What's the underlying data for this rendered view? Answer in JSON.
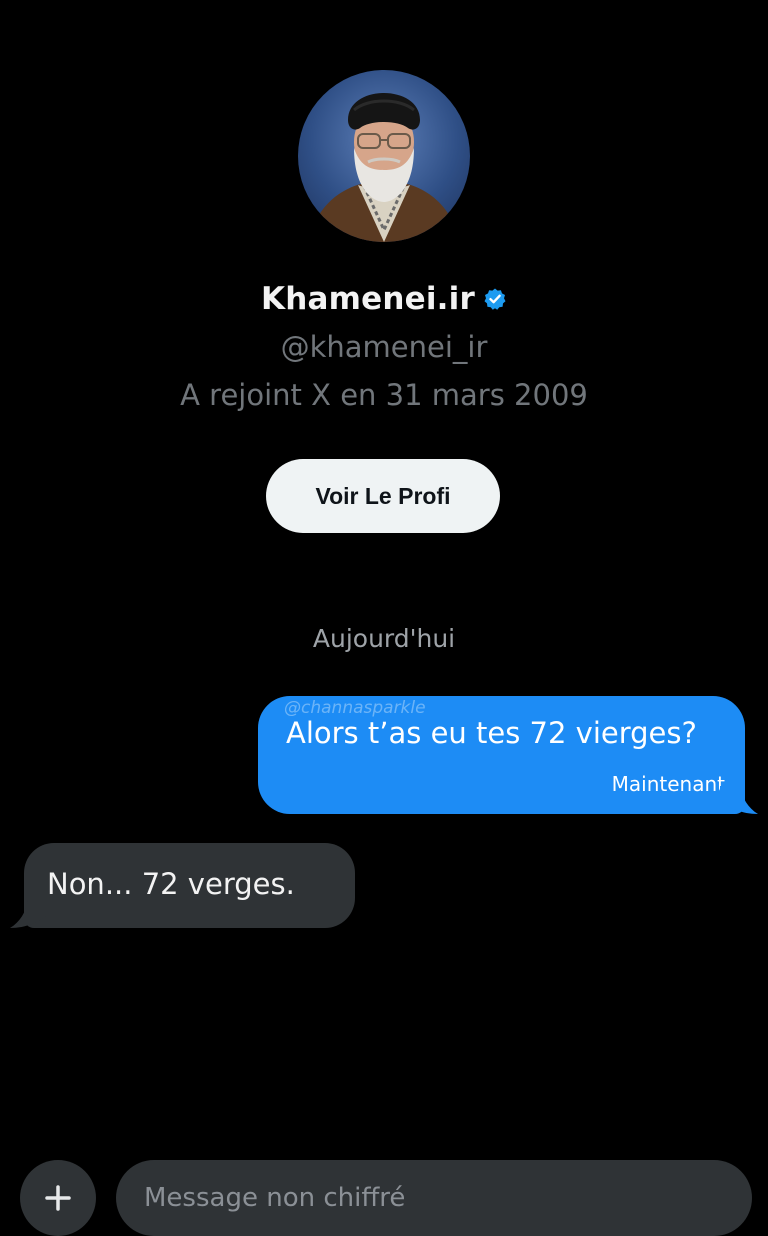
{
  "profile": {
    "name": "Khamenei.ir",
    "handle": "@khamenei_ir",
    "joined": "A rejoint X en 31 mars 2009",
    "view_profile_label": "Voir Le Profi",
    "verified_color": "#1d9bf0"
  },
  "conversation": {
    "date_separator": "Aujourd'hui",
    "messages": [
      {
        "direction": "sent",
        "watermark": "@channasparkle",
        "text": "Alors t’as eu tes 72 vierges?",
        "time": "Maintenant"
      },
      {
        "direction": "received",
        "text": "Non... 72 verges."
      }
    ]
  },
  "composer": {
    "add_icon": "plus-icon",
    "placeholder": "Message non chiffré"
  },
  "colors": {
    "background": "#000000",
    "sent_bubble": "#1d8cf5",
    "received_bubble": "#2f3336",
    "secondary_text": "#71767b"
  }
}
